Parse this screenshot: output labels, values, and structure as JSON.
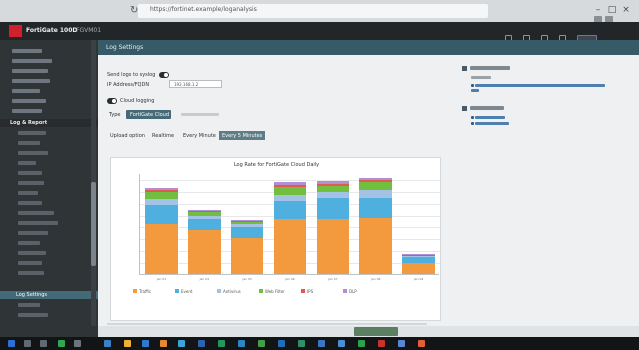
{
  "browser": {
    "url": "https://fortinet.example/loganalysis"
  },
  "app": {
    "title": "FortiGate 100D",
    "hostname": "FGVM01"
  },
  "sidebar": {
    "section_log_report": "Log & Report",
    "active_item": "Log Settings"
  },
  "breadcrumb": "Log Settings",
  "form": {
    "send_logs_label": "Send logs to syslog",
    "ip_label": "IP Address/FQDN",
    "ip_value": "192.168.1.2",
    "cloud_logging_label": "Cloud logging",
    "type_label": "Type",
    "type_selected": "FortiGate Cloud"
  },
  "tabs": [
    {
      "label": "Upload option"
    },
    {
      "label": "Realtime"
    },
    {
      "label": "Every Minute"
    },
    {
      "label": "Every 5 Minutes"
    }
  ],
  "chart_data": {
    "type": "bar",
    "title": "Log Rate for FortiGate Cloud Daily",
    "categories": [
      "Jan 03",
      "Jan 04",
      "Jan 05",
      "Jan 06",
      "Jan 07",
      "Jan 08",
      "Jan 09"
    ],
    "relative_scale_note": "stack heights relative to the tallest bar; y-axis tick values are not legible",
    "series": [
      {
        "name": "Traffic",
        "color": "#f39a3f",
        "values": [
          0.45,
          0.4,
          0.33,
          0.5,
          0.5,
          0.51,
          0.1
        ]
      },
      {
        "name": "Event",
        "color": "#4fb0e0",
        "values": [
          0.18,
          0.1,
          0.1,
          0.16,
          0.19,
          0.18,
          0.05
        ]
      },
      {
        "name": "Antivirus",
        "color": "#a3c3e6",
        "values": [
          0.05,
          0.03,
          0.02,
          0.06,
          0.05,
          0.07,
          0.01
        ]
      },
      {
        "name": "Web Filter",
        "color": "#72bf3f",
        "values": [
          0.06,
          0.03,
          0.02,
          0.07,
          0.06,
          0.07,
          0.01
        ]
      },
      {
        "name": "IPS",
        "color": "#e25a4a",
        "values": [
          0.02,
          0.01,
          0.01,
          0.02,
          0.02,
          0.02,
          0.005
        ]
      },
      {
        "name": "DLP",
        "color": "#b28fd4",
        "values": [
          0.02,
          0.01,
          0.01,
          0.02,
          0.02,
          0.02,
          0.005
        ]
      }
    ],
    "legend": "bottom",
    "grid": true
  }
}
